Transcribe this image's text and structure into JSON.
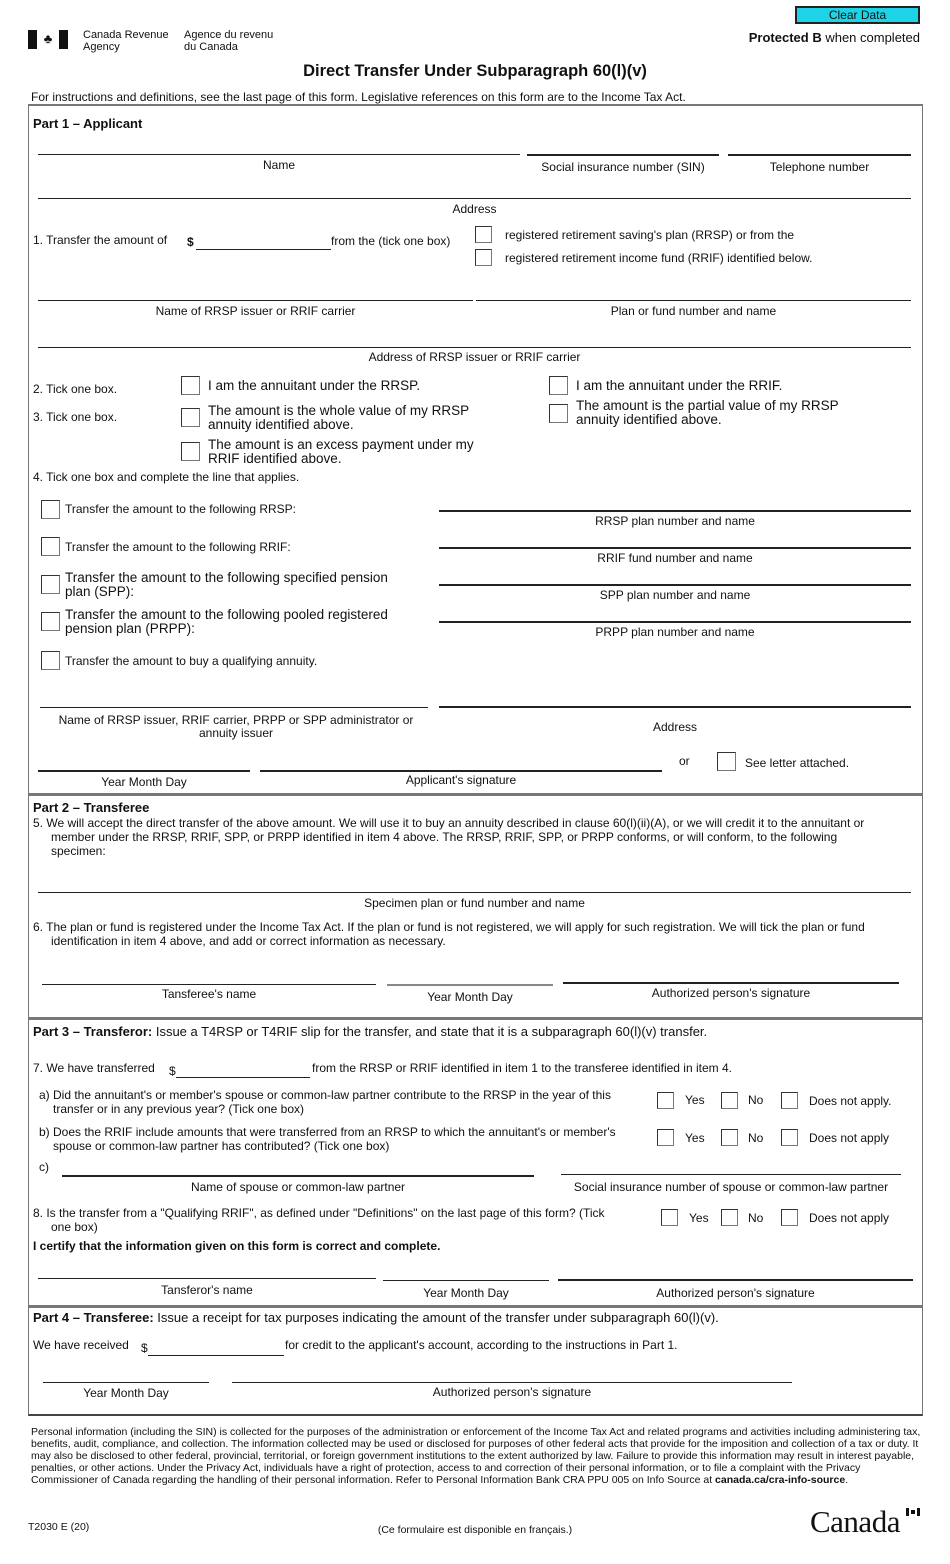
{
  "header": {
    "agency_en_line1": "Canada Revenue",
    "agency_en_line2": "Agency",
    "agency_fr_line1": "Agence du revenu",
    "agency_fr_line2": "du Canada",
    "clear_button": "Clear Data",
    "protected_bold": "Protected B",
    "protected_rest": " when completed",
    "title": "Direct Transfer Under Subparagraph 60(l)(v)",
    "instructions": "For instructions and definitions, see the last page of this form. Legislative references on this form are to the Income Tax Act.",
    "flag_icon": "canada-flag-icon"
  },
  "part1": {
    "title": "Part 1 – Applicant",
    "name_label": "Name",
    "sin_label": "Social insurance number (SIN)",
    "phone_label": "Telephone number",
    "address_label": "Address",
    "item1_prefix": "1.  Transfer the amount of",
    "dollar": "$",
    "item1_from": "from the (tick one box)",
    "item1_opt_rrsp": "registered retirement saving's plan (RRSP) or from the",
    "item1_opt_rrif": "registered retirement income fund (RRIF) identified below.",
    "issuer_name_label": "Name of RRSP issuer or RRIF carrier",
    "plan_label": "Plan or fund number and name",
    "issuer_address_label": "Address of RRSP issuer or RRIF carrier",
    "item2_label": "2.  Tick one box.",
    "item2_opt_rrsp": "I am the annuitant under the RRSP.",
    "item2_opt_rrif": "I am the annuitant under the RRIF.",
    "item3_label": "3.  Tick one box.",
    "item3_opt_whole_1": "The amount is the whole value of my RRSP",
    "item3_opt_whole_2": "annuity identified above.",
    "item3_opt_partial_1": "The amount is the partial value of my RRSP",
    "item3_opt_partial_2": "annuity identified above.",
    "item3_opt_excess_1": "The amount is an excess payment under my",
    "item3_opt_excess_2": "RRIF identified above.",
    "item4_label": "4.  Tick one box and complete the line that applies.",
    "item4_options": [
      {
        "label": "Transfer the amount to the following RRSP:",
        "line_label": "RRSP plan number and name"
      },
      {
        "label": "Transfer the amount to the following RRIF:",
        "line_label": "RRIF fund number and name"
      },
      {
        "label_1": "Transfer the amount to the following specified pension",
        "label_2": "plan (SPP):",
        "line_label": "SPP plan number and name"
      },
      {
        "label_1": "Transfer the amount to the following pooled registered",
        "label_2": "pension plan (PRPP):",
        "line_label": "PRPP plan number and name"
      },
      {
        "label": "Transfer the amount to buy a qualifying annuity."
      }
    ],
    "admin_name_label_1": "Name of RRSP issuer, RRIF carrier, PRPP or SPP administrator or",
    "admin_name_label_2": "annuity issuer",
    "admin_address_label": "Address",
    "or_label": "or",
    "letter_label": "See letter attached.",
    "date_label": "Year  Month  Day",
    "signature_label": "Applicant's signature"
  },
  "part2": {
    "title": "Part 2 – Transferee",
    "item5_1": "5.  We will accept the direct transfer of the above amount. We will use it to buy an annuity described in clause 60(l)(ii)(A), or we will credit it to the annuitant or",
    "item5_2": "member under the RRSP, RRIF, SPP, or PRPP identified in item 4 above. The RRSP, RRIF, SPP, or PRPP conforms, or will conform, to the following",
    "item5_3": "specimen:",
    "specimen_label": "Specimen plan or fund number and name",
    "item6_1": "6.  The plan or fund is registered under the Income Tax Act. If the plan or fund is not registered, we will apply for such registration. We will tick the plan or fund",
    "item6_2": "identification in item 4 above, and add or correct information as necessary.",
    "transferee_name_label": "Tansferee's name",
    "date_label": "Year  Month  Day",
    "signature_label": "Authorized person's signature"
  },
  "part3": {
    "title_bold": "Part 3 – Transferor:",
    "title_rest": " Issue a T4RSP or T4RIF slip for the transfer, and state that it is a subparagraph 60(l)(v) transfer.",
    "item7_prefix": "7.  We have transferred",
    "dollar": "$",
    "item7_suffix": "from the RRSP or RRIF identified in item 1 to the transferee identified in item 4.",
    "qa_1": "a) Did the annuitant's or member's spouse or common-law partner contribute to the RRSP in the year of this",
    "qa_2": "transfer or in any previous year? (Tick one box)",
    "qb_1": "b) Does the RRIF include amounts that were transferred from an RRSP to which the annuitant's or member's",
    "qb_2": "spouse or common-law partner has contributed? (Tick one box)",
    "qc": "c)",
    "spouse_name_label": "Name of spouse or common-law partner",
    "spouse_sin_label": "Social insurance number of spouse or common-law partner",
    "q8_1": "8.  Is the transfer from a \"Qualifying RRIF\", as defined under \"Definitions\" on the last page of this form? (Tick",
    "q8_2": "one box)",
    "yes": "Yes",
    "no": "No",
    "na_a": "Does not apply.",
    "na": "Does not apply",
    "certify": "I certify that the information given on this form is correct and complete.",
    "transferor_name_label": "Tansferor's name",
    "date_label": "Year  Month  Day",
    "signature_label": "Authorized person's signature"
  },
  "part4": {
    "title_bold": "Part 4 – Transferee:",
    "title_rest": " Issue a receipt for tax purposes indicating the amount of the transfer under subparagraph 60(l)(v).",
    "received_prefix": "We have received",
    "dollar": "$",
    "received_suffix": "for credit to the applicant's account, according to the instructions in Part 1.",
    "date_label": "Year  Month  Day",
    "signature_label": "Authorized person's signature"
  },
  "footer": {
    "privacy": "Personal information (including the SIN) is collected for the purposes of the administration or enforcement of the Income Tax Act and related programs and activities including administering tax, benefits, audit, compliance, and collection. The information collected may be used or disclosed for purposes of other federal acts that provide for the imposition and collection of a tax or duty. It may also be disclosed to other federal, provincial, territorial, or foreign government institutions to the extent authorized by law. Failure to provide this information may result in interest payable, penalties, or other actions. Under the Privacy Act, individuals have a right of protection, access to and correction of their personal information, or to file a complaint with the Privacy Commissioner of Canada regarding the handling of their personal information. Refer to Personal Information Bank CRA PPU 005 on Info Source at ",
    "privacy_link": "canada.ca/cra-info-source",
    "privacy_end": ".",
    "form_code": "T2030 E (20)",
    "french_note": "(Ce formulaire est disponible en français.)",
    "wordmark": "Canada"
  },
  "colors": {
    "clear_button_bg": "#1fd3e6"
  }
}
